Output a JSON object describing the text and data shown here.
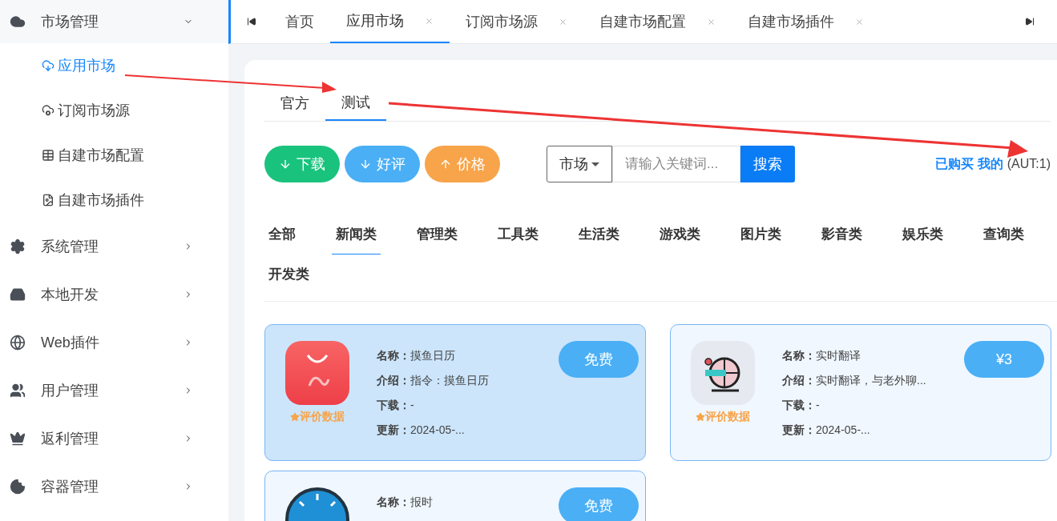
{
  "sidebar": {
    "groups": [
      {
        "label": "市场管理",
        "expanded": true,
        "children": [
          {
            "label": "应用市场",
            "selected": true
          },
          {
            "label": "订阅市场源",
            "selected": false
          },
          {
            "label": "自建市场配置",
            "selected": false
          },
          {
            "label": "自建市场插件",
            "selected": false
          }
        ]
      },
      {
        "label": "系统管理",
        "expanded": false
      },
      {
        "label": "本地开发",
        "expanded": false
      },
      {
        "label": "Web插件",
        "expanded": false
      },
      {
        "label": "用户管理",
        "expanded": false
      },
      {
        "label": "返利管理",
        "expanded": false
      },
      {
        "label": "容器管理",
        "expanded": false
      }
    ]
  },
  "tabs": [
    {
      "label": "首页",
      "selected": false,
      "closable": false
    },
    {
      "label": "应用市场",
      "selected": true,
      "closable": true
    },
    {
      "label": "订阅市场源",
      "selected": false,
      "closable": true
    },
    {
      "label": "自建市场配置",
      "selected": false,
      "closable": true
    },
    {
      "label": "自建市场插件",
      "selected": false,
      "closable": true
    }
  ],
  "source_tabs": [
    {
      "label": "官方",
      "selected": false
    },
    {
      "label": "测试",
      "selected": true
    }
  ],
  "sort_buttons": [
    {
      "label": "下载",
      "kind": "down",
      "color": "#19c37d"
    },
    {
      "label": "好评",
      "kind": "down",
      "color": "#4aaff5"
    },
    {
      "label": "价格",
      "kind": "up",
      "color": "#f7a44a"
    }
  ],
  "search": {
    "scope": "市场",
    "placeholder": "请输入关键词...",
    "button": "搜索"
  },
  "links": [
    {
      "label": "已购买"
    },
    {
      "label": "我的"
    }
  ],
  "aut": "(AUT:1)",
  "categories": [
    {
      "label": "全部",
      "selected": false
    },
    {
      "label": "新闻类",
      "selected": true
    },
    {
      "label": "管理类",
      "selected": false
    },
    {
      "label": "工具类",
      "selected": false
    },
    {
      "label": "生活类",
      "selected": false
    },
    {
      "label": "游戏类",
      "selected": false
    },
    {
      "label": "图片类",
      "selected": false
    },
    {
      "label": "影音类",
      "selected": false
    },
    {
      "label": "娱乐类",
      "selected": false
    },
    {
      "label": "查询类",
      "selected": false
    },
    {
      "label": "开发类",
      "selected": false
    }
  ],
  "apps": [
    {
      "selected": true,
      "rating": "评价数据",
      "price": "免费",
      "lines": [
        "**名称：**摸鱼日历",
        "**介绍：**指令：摸鱼日历",
        "**下载：**-",
        "**更新：**2024-05-..."
      ]
    },
    {
      "selected": false,
      "rating": "评价数据",
      "price": "¥3",
      "lines": [
        "**名称：**实时翻译",
        "**介绍：**实时翻译，与老外聊...",
        "**下载：**-",
        "**更新：**2024-05-..."
      ]
    },
    {
      "selected": false,
      "price": "免费",
      "lines": [
        "**名称：**报时"
      ]
    }
  ]
}
